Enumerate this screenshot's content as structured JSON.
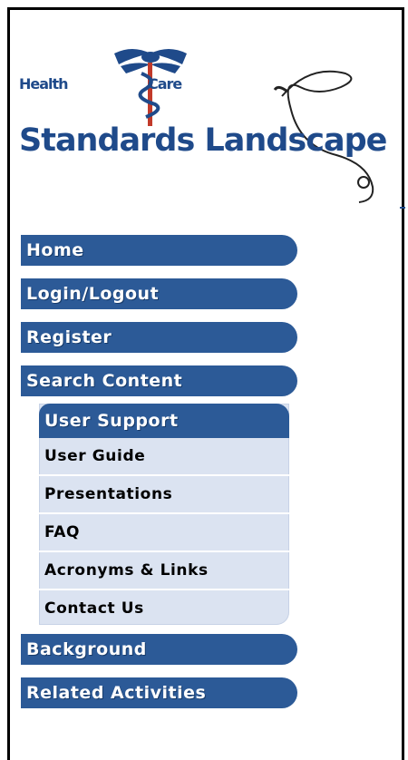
{
  "logo": {
    "line1a": "Health",
    "line1b": "Care",
    "line2": "Standards Landscape"
  },
  "nav": {
    "home": "Home",
    "login": "Login/Logout",
    "register": "Register",
    "search": "Search Content",
    "user_support": {
      "header": "User Support",
      "items": [
        "User Guide",
        "Presentations",
        "FAQ",
        "Acronyms & Links",
        "Contact Us"
      ]
    },
    "background": "Background",
    "related": "Related Activities"
  },
  "colors": {
    "nav_blue": "#2c5a97",
    "sub_bg": "#dbe3f1",
    "logo_blue": "#1f4a8a"
  }
}
